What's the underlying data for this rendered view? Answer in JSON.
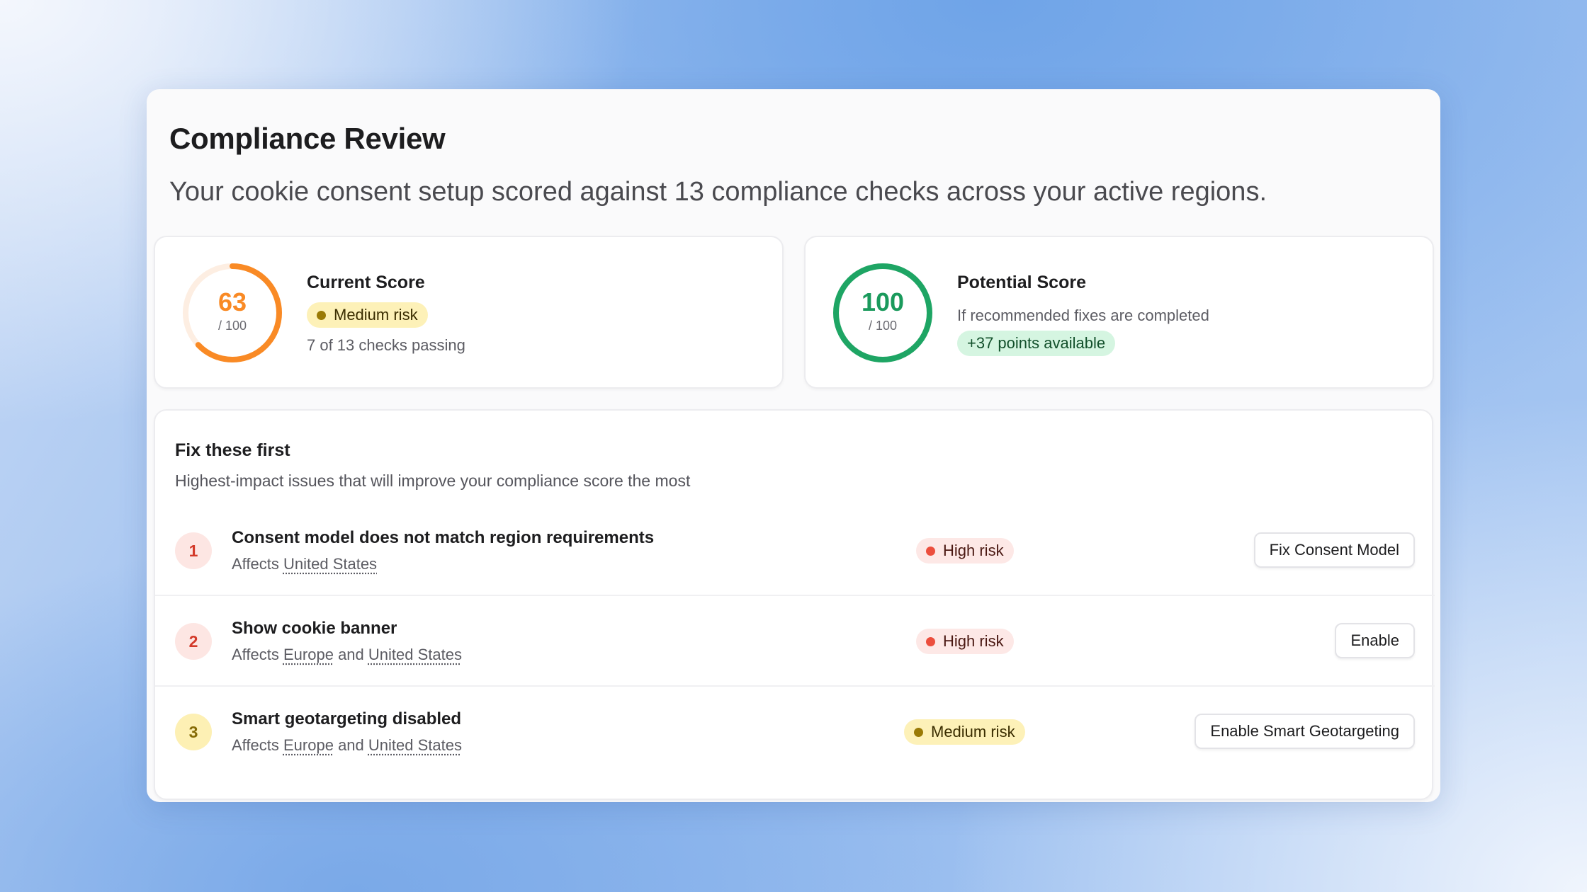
{
  "header": {
    "title": "Compliance Review",
    "subtitle": "Your cookie consent setup scored against 13 compliance checks across your active regions."
  },
  "current_score": {
    "title": "Current Score",
    "value": "63",
    "out_of": "/ 100",
    "progress": 63,
    "risk_label": "Medium risk",
    "checks": "7 of 13 checks passing",
    "color": "#f98a25"
  },
  "potential_score": {
    "title": "Potential Score",
    "value": "100",
    "out_of": "/ 100",
    "progress": 100,
    "description": "If recommended fixes are completed",
    "points_badge": "+37 points available",
    "color": "#1ea564"
  },
  "fix_section": {
    "title": "Fix these first",
    "subtitle": "Highest-impact issues that will improve your compliance score the most",
    "issues": [
      {
        "number": "1",
        "title": "Consent model does not match region requirements",
        "affects_prefix": "Affects",
        "region_1": "United States",
        "risk_label": "High risk",
        "button": "Fix Consent Model"
      },
      {
        "number": "2",
        "title": "Show cookie banner",
        "affects_prefix": "Affects",
        "region_1": "Europe",
        "conjunction": "and",
        "region_2": "United States",
        "risk_label": "High risk",
        "button": "Enable"
      },
      {
        "number": "3",
        "title": "Smart geotargeting disabled",
        "affects_prefix": "Affects",
        "region_1": "Europe",
        "conjunction": "and",
        "region_2": "United States",
        "risk_label": "Medium risk",
        "button": "Enable Smart Geotargeting"
      }
    ]
  },
  "colors": {
    "high_risk": "#ec4e3d",
    "medium_risk": "#9a7a05",
    "success": "#1ea564",
    "warning": "#f98a25"
  }
}
